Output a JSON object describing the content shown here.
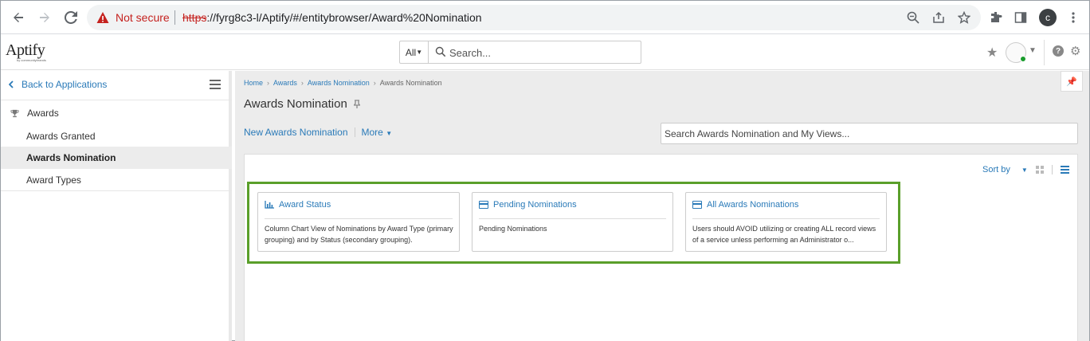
{
  "browser": {
    "not_secure": "Not secure",
    "url_scheme": "https",
    "url_rest": "://fyrg8c3-l/Aptify/#/entitybrowser/Award%20Nomination",
    "profile_initial": "c"
  },
  "header": {
    "logo": "Aptify",
    "logo_sub": "by communitybrands",
    "search_scope": "All",
    "search_placeholder": "Search..."
  },
  "sidebar": {
    "back_label": "Back to Applications",
    "group_label": "Awards",
    "items": [
      {
        "label": "Awards Granted",
        "active": false
      },
      {
        "label": "Awards Nomination",
        "active": true
      },
      {
        "label": "Award Types",
        "active": false
      }
    ]
  },
  "main": {
    "breadcrumb": [
      "Home",
      "Awards",
      "Awards Nomination",
      "Awards Nomination"
    ],
    "title": "Awards Nomination",
    "new_label": "New Awards Nomination",
    "more_label": "More",
    "search_placeholder": "Search Awards Nomination and My Views...",
    "sort_label": "Sort by",
    "cards": [
      {
        "title": "Award Status",
        "icon": "bar-chart-icon",
        "body": "Column Chart View of Nominations by Award Type (primary grouping) and by Status (secondary grouping)."
      },
      {
        "title": "Pending Nominations",
        "icon": "grid-view-icon",
        "body": "Pending Nominations"
      },
      {
        "title": "All Awards Nominations",
        "icon": "grid-view-icon",
        "body": "Users should AVOID utilizing or creating ALL record views of a service unless performing an Administrator o..."
      }
    ]
  },
  "colors": {
    "link": "#2a7ab8",
    "highlight": "#5a9f2a",
    "not_secure": "#c5221f"
  }
}
